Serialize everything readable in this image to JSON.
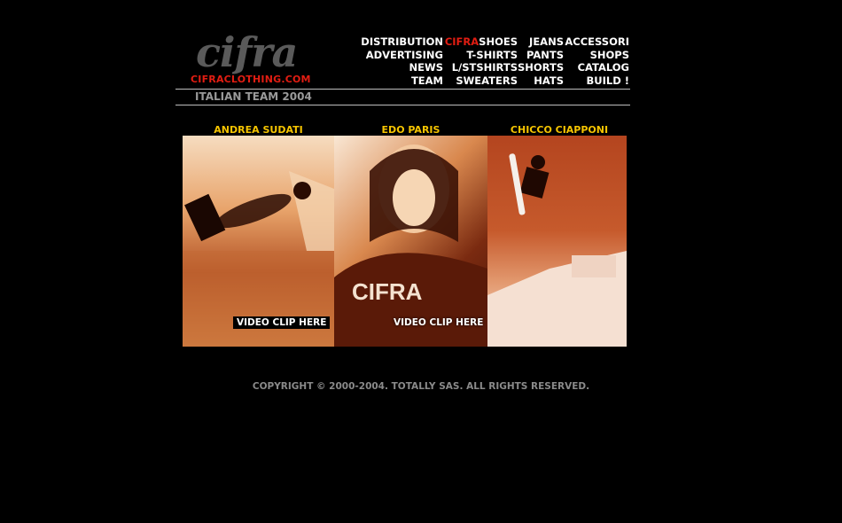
{
  "logo": {
    "word": "cifra",
    "url": "CIFRACLOTHING.COM"
  },
  "nav": {
    "col1": [
      "DISTRIBUTION",
      "ADVERTISING",
      "NEWS",
      "TEAM"
    ],
    "col2_first_brand": "CIFRA",
    "col2_first_rest": "SHOES",
    "col2": [
      "T-SHIRTS",
      "L/STSHIRTS",
      "SWEATERS"
    ],
    "col3": [
      "JEANS",
      "PANTS",
      "SHORTS",
      "HATS"
    ],
    "col4": [
      "ACCESSORI",
      "SHOPS",
      "CATALOG",
      "BUILD !"
    ]
  },
  "page_title": "ITALIAN TEAM 2004",
  "riders": [
    {
      "name": "ANDREA SUDATI",
      "video_label": "VIDEO CLIP HERE"
    },
    {
      "name": "EDO PARIS",
      "video_label": "VIDEO CLIP HERE"
    },
    {
      "name": "CHICCO CIAPPONI"
    }
  ],
  "copyright": "COPYRIGHT © 2000-2004. TOTALLY SAS. ALL RIGHTS RESERVED.",
  "colors": {
    "background": "#000000",
    "accent_red": "#e21d12",
    "rider_name_yellow": "#f5c400"
  }
}
